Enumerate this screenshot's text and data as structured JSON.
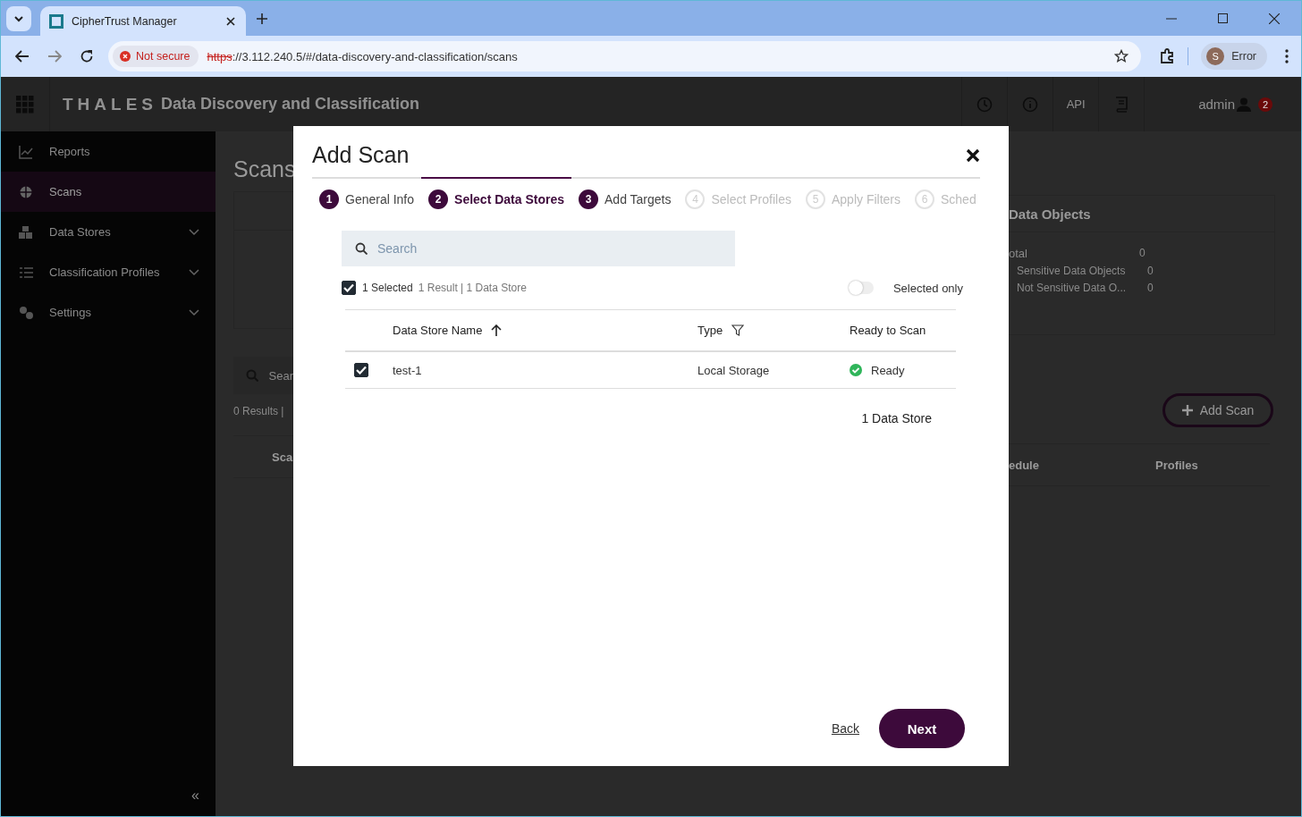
{
  "browser": {
    "tab_title": "CipherTrust Manager",
    "security_label": "Not secure",
    "url_scheme": "https",
    "url_rest": "://3.112.240.5/#/data-discovery-and-classification/scans",
    "profile_initial": "S",
    "profile_label": "Error"
  },
  "header": {
    "brand": "THALES",
    "title": "Data Discovery and Classification",
    "api_label": "API",
    "user": "admin",
    "notification_count": "2"
  },
  "sidebar": {
    "items": [
      {
        "label": "Reports",
        "selected": false,
        "expandable": false
      },
      {
        "label": "Scans",
        "selected": true,
        "expandable": false
      },
      {
        "label": "Data Stores",
        "selected": false,
        "expandable": true
      },
      {
        "label": "Classification Profiles",
        "selected": false,
        "expandable": true
      },
      {
        "label": "Settings",
        "selected": false,
        "expandable": true
      }
    ],
    "collapse": "«"
  },
  "background": {
    "page_title": "Scans",
    "search_placeholder": "Sear",
    "results": "0 Results |",
    "column_1": "Sca",
    "card_title": "Data Objects",
    "stats": [
      {
        "label": "otal",
        "value": "0"
      },
      {
        "label": "Sensitive Data Objects",
        "value": "0"
      },
      {
        "label": "Not Sensitive Data O...",
        "value": "0"
      }
    ],
    "add_button": "Add Scan",
    "column_2": "edule",
    "column_3": "Profiles"
  },
  "dialog": {
    "title": "Add Scan",
    "steps": [
      {
        "number": "1",
        "label": "General Info",
        "selected": false,
        "disabled": false
      },
      {
        "number": "2",
        "label": "Select Data Stores",
        "selected": true,
        "disabled": false
      },
      {
        "number": "3",
        "label": "Add Targets",
        "selected": false,
        "disabled": false
      },
      {
        "number": "4",
        "label": "Select Profiles",
        "selected": false,
        "disabled": true
      },
      {
        "number": "5",
        "label": "Apply Filters",
        "selected": false,
        "disabled": true
      },
      {
        "number": "6",
        "label": "Sched",
        "selected": false,
        "disabled": true
      }
    ],
    "search_placeholder": "Search",
    "selection": {
      "checked": true,
      "selected_text": "1 Selected",
      "summary": "1 Result | 1 Data Store"
    },
    "toggle": {
      "label": "Selected only",
      "on": false
    },
    "columns": [
      {
        "label": "Data Store Name",
        "kind": "sort"
      },
      {
        "label": "Type",
        "kind": "filter"
      },
      {
        "label": "Ready to Scan",
        "kind": "plain"
      }
    ],
    "rows": [
      {
        "checked": true,
        "name": "test-1",
        "type": "Local Storage",
        "status": "Ready",
        "ready": true
      }
    ],
    "footer": "1 Data Store",
    "back": "Back",
    "next": "Next"
  }
}
